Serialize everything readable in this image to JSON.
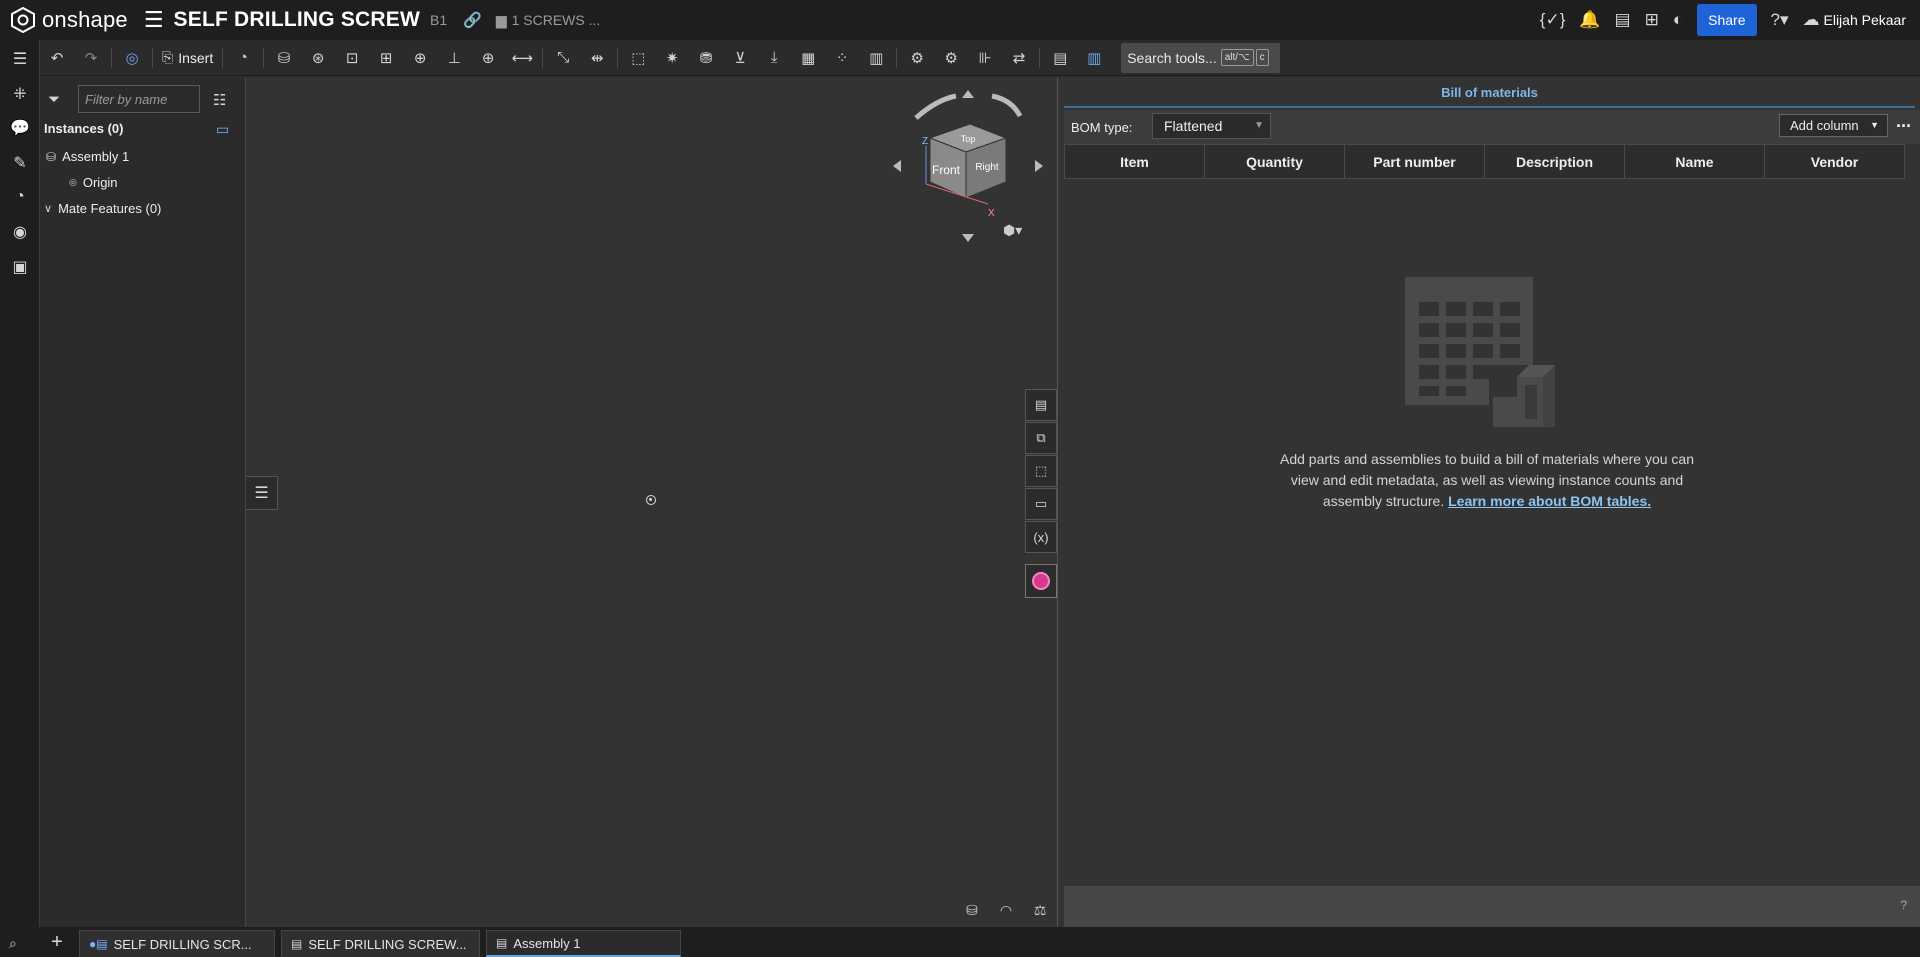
{
  "app": {
    "brand": "onshape",
    "document_title": "SELF DRILLING SCREW",
    "version": "B1",
    "folder": "1 SCREWS ..."
  },
  "header": {
    "share_label": "Share",
    "user_name": "Elijah Pekaar"
  },
  "toolbar": {
    "insert_label": "Insert",
    "search_placeholder": "Search tools...",
    "search_shortcut_1": "alt/⌥",
    "search_shortcut_2": "c"
  },
  "feature_tree": {
    "filter_placeholder": "Filter by name",
    "instances_header": "Instances (0)",
    "items": [
      {
        "label": "Assembly 1"
      },
      {
        "label": "Origin"
      },
      {
        "label": "Mate Features (0)"
      }
    ]
  },
  "view_cube": {
    "top": "Top",
    "front": "Front",
    "right": "Right",
    "axis_x": "X",
    "axis_z": "Z"
  },
  "bom": {
    "title": "Bill of materials",
    "type_label": "BOM type:",
    "type_value": "Flattened",
    "add_column_label": "Add column",
    "columns": [
      "Item",
      "Quantity",
      "Part number",
      "Description",
      "Name",
      "Vendor"
    ],
    "empty_message": "Add parts and assemblies to build a bill of materials where you can view and edit metadata, as well as viewing instance counts and assembly structure.",
    "learn_more": "Learn more about BOM tables."
  },
  "tabs": [
    {
      "label": "SELF DRILLING SCR...",
      "active": false
    },
    {
      "label": "SELF DRILLING SCREW...",
      "active": false
    },
    {
      "label": "Assembly 1",
      "active": true
    }
  ],
  "colors": {
    "accent": "#1e63d8",
    "link": "#8cc4f2",
    "appearance": "#d9388f"
  }
}
